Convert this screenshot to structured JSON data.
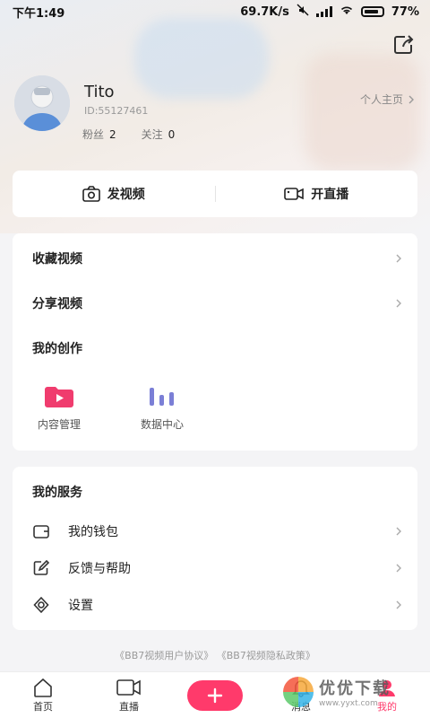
{
  "status_bar": {
    "time": "下午1:49",
    "speed": "69.7K/s",
    "battery": "77%"
  },
  "profile": {
    "name": "Tito",
    "id": "ID:55127461",
    "homepage_link": "个人主页",
    "fans_label": "粉丝",
    "fans_count": "2",
    "following_label": "关注",
    "following_count": "0"
  },
  "actions": {
    "post_video": "发视频",
    "go_live": "开直播"
  },
  "creation_card": {
    "favorites": "收藏视频",
    "shared": "分享视频",
    "my_creation_title": "我的创作",
    "tools": [
      {
        "label": "内容管理",
        "icon": "video-play-icon"
      },
      {
        "label": "数据中心",
        "icon": "bar-chart-icon"
      }
    ]
  },
  "services_card": {
    "title": "我的服务",
    "items": [
      {
        "label": "我的钱包",
        "icon": "wallet-icon"
      },
      {
        "label": "反馈与帮助",
        "icon": "edit-icon"
      },
      {
        "label": "设置",
        "icon": "settings-icon"
      }
    ]
  },
  "agreements": {
    "user_agreement": "《BB7视频用户协议》",
    "privacy_policy": "《BB7视频隐私政策》"
  },
  "tabbar": {
    "home": "首页",
    "live": "直播",
    "messages": "消息",
    "mine": "我的"
  },
  "watermark": {
    "title": "优优下载",
    "url": "www.yyxt.com"
  },
  "colors": {
    "accent": "#ff3a6b",
    "creation_icon_pink": "#f03c6e",
    "creation_icon_purple": "#7b7fd6"
  }
}
